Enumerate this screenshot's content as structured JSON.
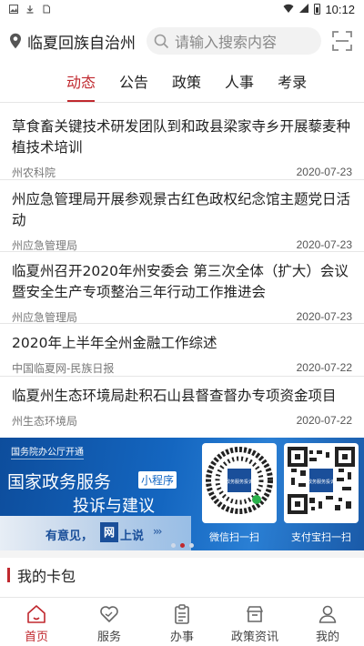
{
  "status_bar": {
    "time": "10:12",
    "icons": [
      "image-icon",
      "download-icon",
      "sim-icon",
      "wifi-icon",
      "signal-icon",
      "battery-icon"
    ]
  },
  "header": {
    "location": "临夏回族自治州",
    "search_placeholder": "请输入搜索内容",
    "scan_icon": "scan-icon"
  },
  "tabs": [
    {
      "label": "动态",
      "active": true
    },
    {
      "label": "公告",
      "active": false
    },
    {
      "label": "政策",
      "active": false
    },
    {
      "label": "人事",
      "active": false
    },
    {
      "label": "考录",
      "active": false
    }
  ],
  "news": [
    {
      "title": "草食畜关键技术研发团队到和政县梁家寺乡开展藜麦种植技术培训",
      "source": "州农科院",
      "date": "2020-07-23"
    },
    {
      "title": "州应急管理局开展参观景古红色政权纪念馆主题党日活动",
      "source": "州应急管理局",
      "date": "2020-07-23"
    },
    {
      "title": "临夏州召开2020年州安委会 第三次全体（扩大）会议暨安全生产专项整治三年行动工作推进会",
      "source": "州应急管理局",
      "date": "2020-07-23"
    },
    {
      "title": "2020年上半年全州金融工作综述",
      "source": "中国临夏网-民族日报",
      "date": "2020-07-22"
    },
    {
      "title": "临夏州生态环境局赴积石山县督查督办专项资金项目",
      "source": "州生态环境局",
      "date": "2020-07-22"
    }
  ],
  "banner": {
    "tag": "国务院办公厅开通",
    "title": "国家政务服务",
    "mini_program": "小程序",
    "subtitle": "投诉与建议",
    "slogan_a": "有意见，",
    "slogan_stamp": "网",
    "slogan_b": "上说",
    "qr_wechat_caption": "微信扫一扫",
    "qr_alipay_caption": "支付宝扫一扫",
    "qr_center_text": "政务服务投诉",
    "carousel_total": 3,
    "carousel_active": 2
  },
  "wallet": {
    "title": "我的卡包"
  },
  "bottom_nav": [
    {
      "label": "首页",
      "icon": "home-icon",
      "active": true
    },
    {
      "label": "服务",
      "icon": "heart-hands-icon",
      "active": false
    },
    {
      "label": "办事",
      "icon": "clipboard-icon",
      "active": false
    },
    {
      "label": "政策资讯",
      "icon": "shop-icon",
      "active": false
    },
    {
      "label": "我的",
      "icon": "user-icon",
      "active": false
    }
  ],
  "colors": {
    "accent": "#c0282e",
    "banner_blue": "#1466c0"
  }
}
